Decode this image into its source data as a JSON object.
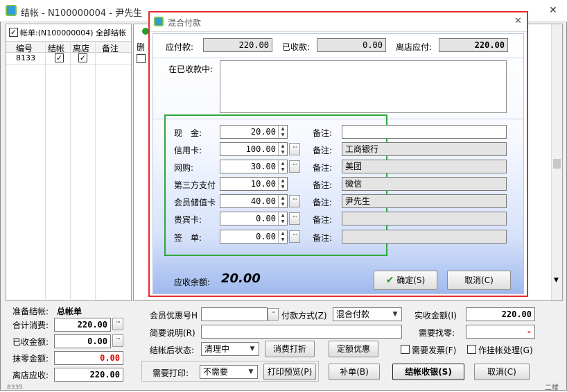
{
  "window": {
    "title": "结帐 - N100000004 - 尹先生",
    "close_glyph": "✕"
  },
  "left": {
    "checkbox_label": "帐单:(N100000004) 全部结帐",
    "columns": [
      "编号",
      "结帐",
      "离店",
      "备注"
    ],
    "row": {
      "id": "8133"
    },
    "del_col": "删",
    "bottom_partial": "8335"
  },
  "summary": {
    "pending_label": "准备结帐:",
    "pending_value": "总帐单",
    "total_label": "合计消费:",
    "total_value": "220.00",
    "received_label": "已收金额:",
    "received_value": "0.00",
    "writeoff_label": "抹零金额:",
    "writeoff_value": "0.00",
    "due_label": "离店应收:",
    "due_value": "220.00"
  },
  "checkout": {
    "member_label": "会员优惠号H",
    "paymode_label": "付款方式(Z)",
    "paymode_value": "混合付款",
    "actual_label": "实收金额(I)",
    "actual_value": "220.00",
    "brief_label": "简要说明(R)",
    "change_label": "需要找零:",
    "change_value": "-",
    "after_label": "结帐后状态:",
    "after_value": "清理中",
    "discount_print_btn": "消费打折",
    "fixed_discount_btn": "定额优惠",
    "invoice_label": "需要发票(F)",
    "void_label": "作挂帐处理(G)",
    "print_label": "需要打印:",
    "print_value": "不需要",
    "preview_btn": "打印预览(P)",
    "supplement_btn": "补单(B)",
    "checkout_btn": "结帐收银(S)",
    "cancel_btn": "取消(C)",
    "partial_bottom": "二楼"
  },
  "dialog": {
    "title": "混合付款",
    "close_glyph": "✕",
    "payable_label": "应付款:",
    "payable_value": "220.00",
    "received_label": "已收款:",
    "received_value": "0.00",
    "checkout_label": "离店应付:",
    "checkout_value": "220.00",
    "in_received_label": "在已收款中:",
    "remark_label": "备注:",
    "payments": [
      {
        "label": "现　金:",
        "amount": "20.00",
        "remark": "",
        "has_dots": false
      },
      {
        "label": "信用卡:",
        "amount": "100.00",
        "remark": "工商银行",
        "has_dots": true
      },
      {
        "label": "网购:",
        "amount": "30.00",
        "remark": "美团",
        "has_dots": true
      },
      {
        "label": "第三方支付",
        "amount": "10.00",
        "remark": "微信",
        "has_dots": false
      },
      {
        "label": "会员储值卡",
        "amount": "40.00",
        "remark": "尹先生",
        "has_dots": true
      },
      {
        "label": "贵宾卡:",
        "amount": "0.00",
        "remark": "",
        "has_dots": true
      },
      {
        "label": "签　单:",
        "amount": "0.00",
        "remark": "",
        "has_dots": true
      }
    ],
    "balance_label": "应收余额:",
    "balance_value": "20.00",
    "ok_btn": "确定(S)",
    "cancel_btn": "取消(C)"
  }
}
